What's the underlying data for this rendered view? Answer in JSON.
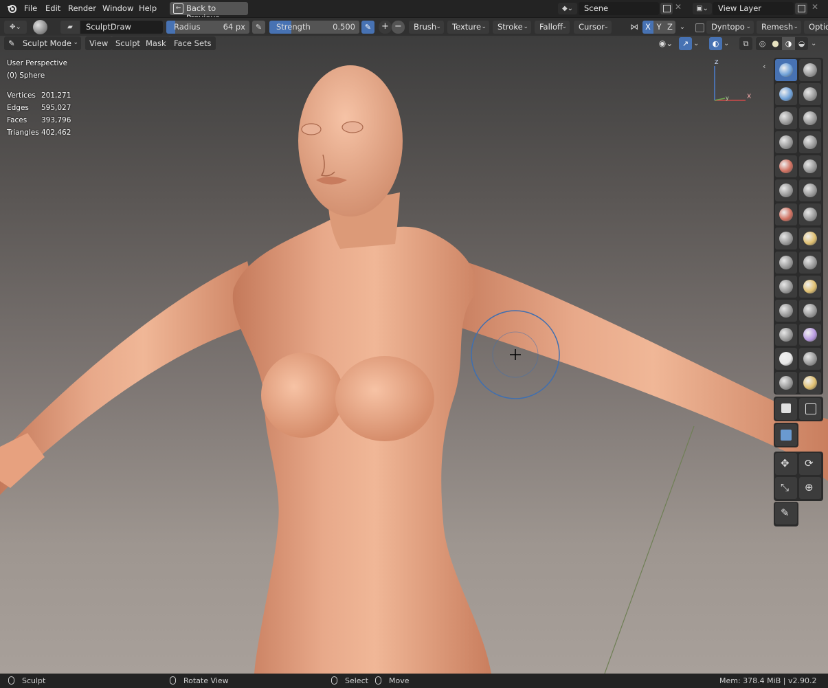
{
  "menu": {
    "items": [
      "File",
      "Edit",
      "Render",
      "Window",
      "Help"
    ],
    "back_button": "Back to Previous",
    "scene": "Scene",
    "view_layer": "View Layer"
  },
  "tool_settings": {
    "brush_name": "SculptDraw",
    "radius_label": "Radius",
    "radius_value": "64 px",
    "strength_label": "Strength",
    "strength_value": "0.500",
    "strength_fraction": 0.5,
    "dropdowns": [
      "Brush",
      "Texture",
      "Stroke",
      "Falloff",
      "Cursor"
    ],
    "axes": [
      "X",
      "Y",
      "Z"
    ],
    "dyntopo": "Dyntopo",
    "remesh": "Remesh",
    "options": "Optio"
  },
  "mode_bar": {
    "mode": "Sculpt Mode",
    "items": [
      "View",
      "Sculpt",
      "Mask",
      "Face Sets"
    ]
  },
  "viewport_info": {
    "perspective": "User Perspective",
    "object": "(0) Sphere",
    "stats": [
      {
        "label": "Vertices",
        "value": "201,271"
      },
      {
        "label": "Edges",
        "value": "595,027"
      },
      {
        "label": "Faces",
        "value": "393,796"
      },
      {
        "label": "Triangles",
        "value": "402,462"
      }
    ]
  },
  "gizmo": {
    "z": "Z",
    "y": "y",
    "x": "X"
  },
  "status_bar": {
    "mode": "Sculpt",
    "rotate": "Rotate View",
    "select": "Select",
    "move": "Move",
    "mem": "Mem: 378.4 MiB | v2.90.2"
  },
  "colors": {
    "accent": "#4772b3",
    "skin": "#e3a27f",
    "brush_circle": "#3f6fb0"
  }
}
